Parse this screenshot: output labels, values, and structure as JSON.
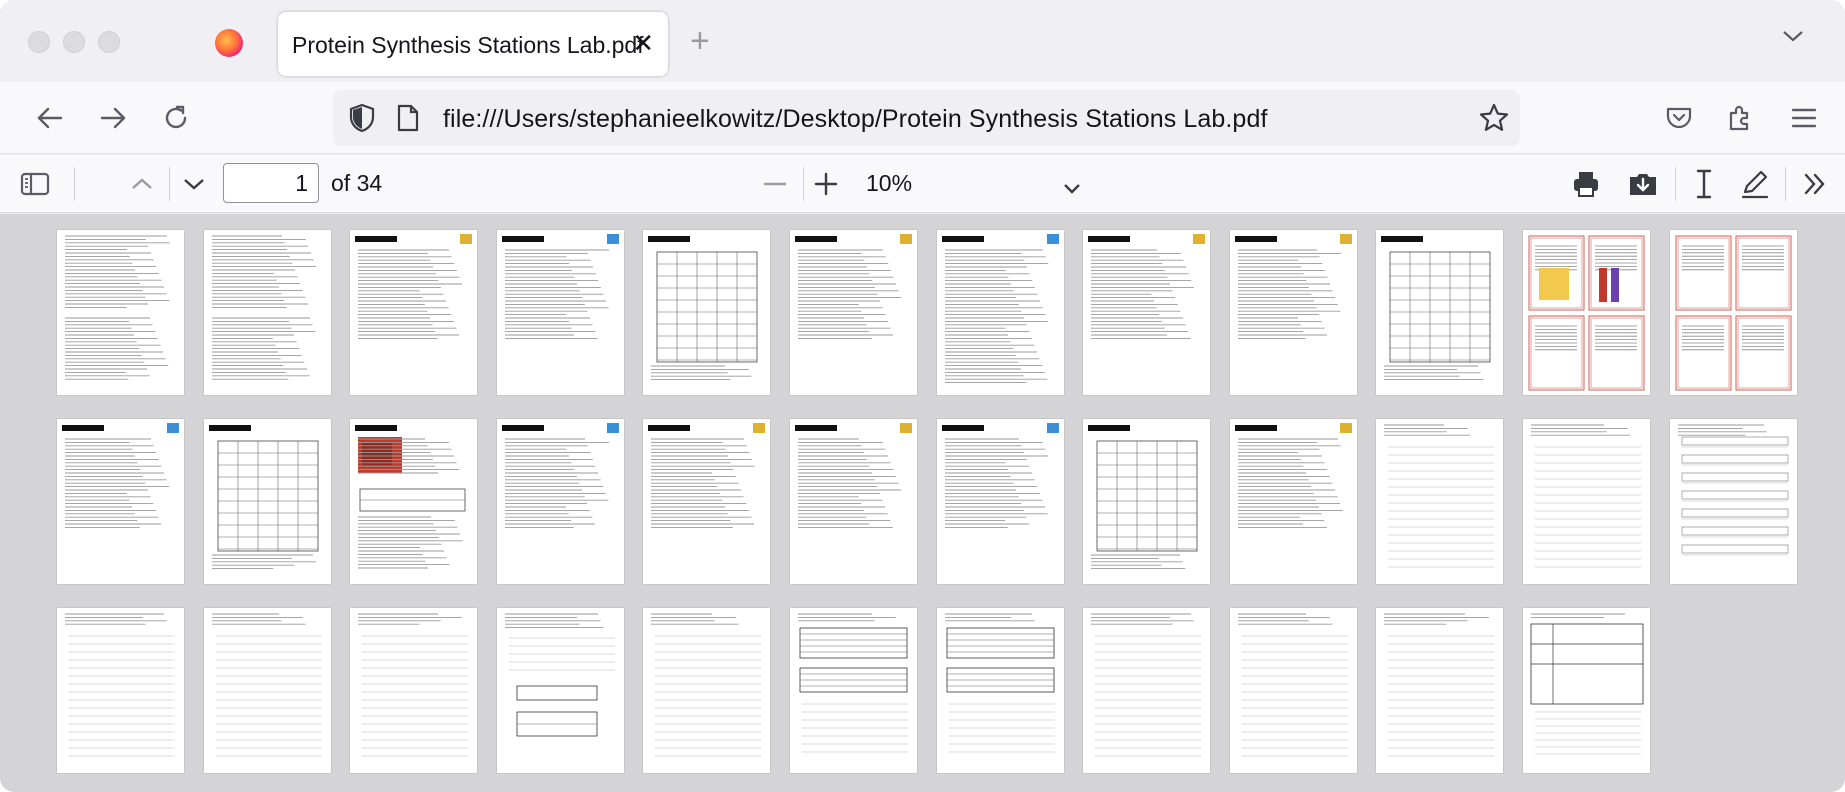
{
  "tab": {
    "title": "Protein Synthesis Stations Lab.pdf"
  },
  "url": {
    "value": "file:///Users/stephanieelkowitz/Desktop/Protein Synthesis Stations Lab.pdf"
  },
  "pdf_toolbar": {
    "page_number": "1",
    "page_count": "of 34",
    "zoom": "10%"
  },
  "icons": [
    "firefox-icon",
    "close-icon",
    "plus-icon",
    "chevron-down-icon",
    "back-arrow-icon",
    "forward-arrow-icon",
    "reload-icon",
    "shield-icon",
    "document-icon",
    "star-icon",
    "pocket-icon",
    "extensions-icon",
    "menu-icon",
    "sidebar-icon",
    "chevron-up-icon",
    "minus-icon",
    "print-icon",
    "download-icon",
    "text-cursor-icon",
    "pen-icon",
    "double-chevron-icon"
  ],
  "thumbnails": [
    {
      "kind": "text"
    },
    {
      "kind": "text"
    },
    {
      "kind": "header"
    },
    {
      "kind": "header"
    },
    {
      "kind": "table"
    },
    {
      "kind": "header"
    },
    {
      "kind": "header-dense"
    },
    {
      "kind": "header"
    },
    {
      "kind": "header"
    },
    {
      "kind": "table"
    },
    {
      "kind": "cards-a"
    },
    {
      "kind": "cards-b"
    },
    {
      "kind": "header"
    },
    {
      "kind": "table"
    },
    {
      "kind": "image"
    },
    {
      "kind": "header"
    },
    {
      "kind": "header"
    },
    {
      "kind": "header"
    },
    {
      "kind": "header"
    },
    {
      "kind": "table"
    },
    {
      "kind": "header"
    },
    {
      "kind": "lines"
    },
    {
      "kind": "lines"
    },
    {
      "kind": "grid-lines"
    },
    {
      "kind": "lines"
    },
    {
      "kind": "lines"
    },
    {
      "kind": "lines"
    },
    {
      "kind": "mixed"
    },
    {
      "kind": "lines"
    },
    {
      "kind": "small-tables"
    },
    {
      "kind": "small-tables"
    },
    {
      "kind": "lines"
    },
    {
      "kind": "lines"
    },
    {
      "kind": "lines"
    },
    {
      "kind": "boxes"
    }
  ]
}
